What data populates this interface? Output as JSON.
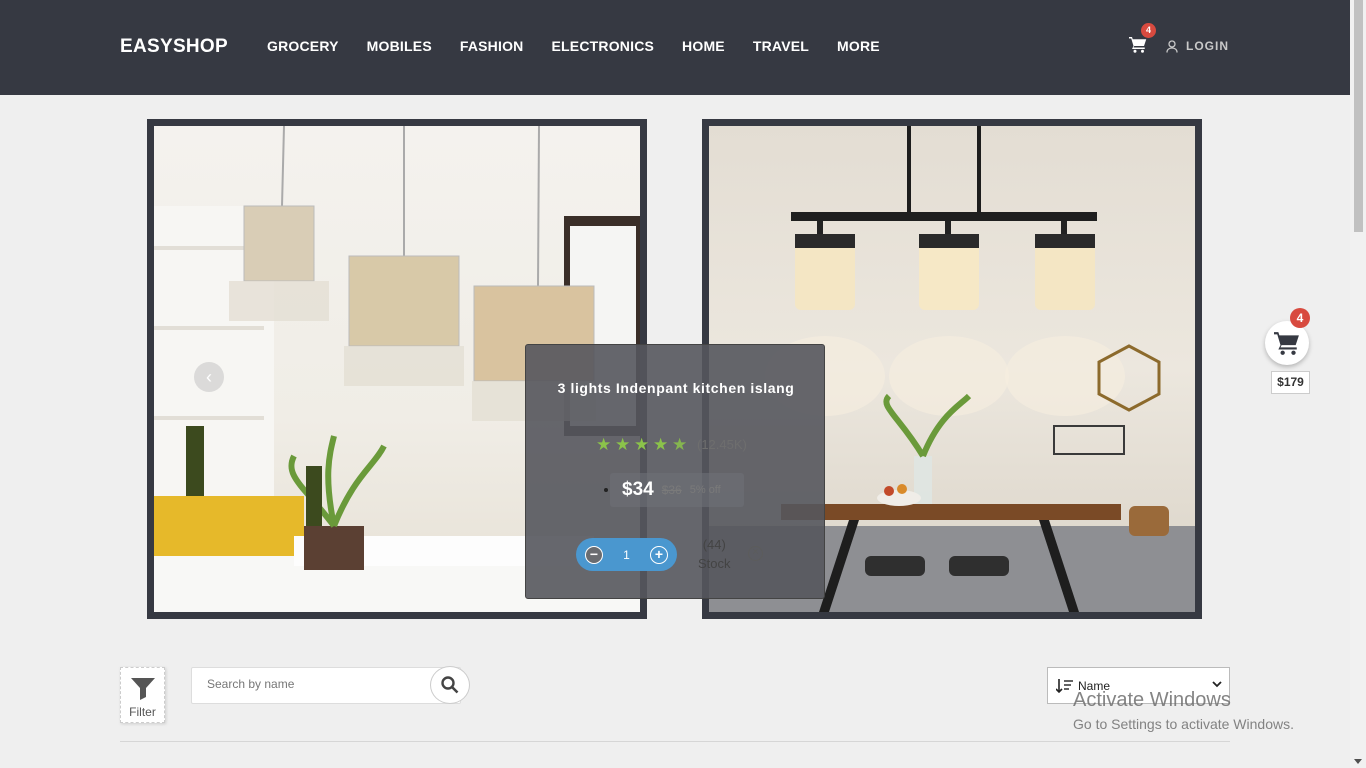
{
  "header": {
    "brand": "EASYSHOP",
    "nav": [
      "GROCERY",
      "MOBILES",
      "FASHION",
      "ELECTRONICS",
      "HOME",
      "TRAVEL",
      "MORE"
    ],
    "cart_count": "4",
    "login_label": "LOGIN"
  },
  "popup": {
    "title": "3 lights Indenpant kitchen islang",
    "rating": 4.5,
    "review_count": "(12.45K)",
    "price": "$34",
    "old_price": "$36",
    "discount": "5% off",
    "quantity": "1",
    "stock_count": "(44)",
    "stock_label": "Stock"
  },
  "floating_cart": {
    "count": "4",
    "total": "$179"
  },
  "toolbar": {
    "filter_label": "Filter",
    "search_placeholder": "Search by name",
    "sort_selected": "Name"
  },
  "watermark": {
    "line1": "Activate Windows",
    "line2": "Go to Settings to activate Windows."
  },
  "colors": {
    "header_bg": "#363942",
    "accent_blue": "#4a97cf",
    "star_green": "#8bc34a",
    "badge_red": "#d84a3f"
  },
  "icons": [
    "cart-icon",
    "user-icon",
    "chevron-left-icon",
    "star-icon",
    "minus-icon",
    "plus-icon",
    "close-circle-icon",
    "filter-icon",
    "search-icon",
    "sort-icon",
    "chevron-down-icon"
  ]
}
